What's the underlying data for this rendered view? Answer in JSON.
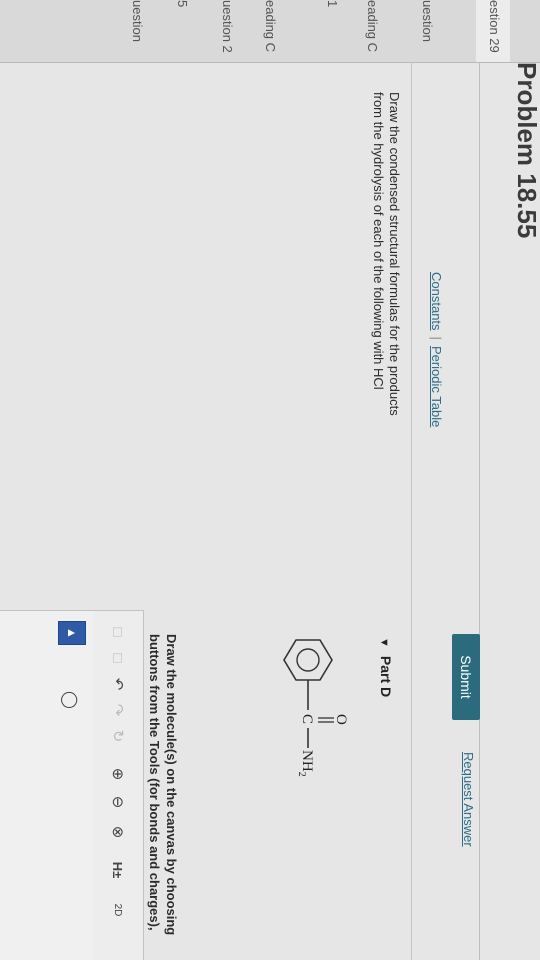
{
  "sidebar": {
    "items": [
      {
        "label": "estion 29"
      },
      {
        "label": "uestion"
      },
      {
        "label": "eading C"
      },
      {
        "label": "1"
      },
      {
        "label": "eading C"
      },
      {
        "label": "uestion 2"
      },
      {
        "label": "5"
      },
      {
        "label": "uestion"
      }
    ]
  },
  "header": {
    "title": "Problem 18.55"
  },
  "links": {
    "constants": "Constants",
    "separator": "|",
    "periodic_table": "Periodic Table"
  },
  "instructions": "Draw the condensed structural formulas for the products from the hydrolysis of each of the following with HCl",
  "actions": {
    "submit": "Submit",
    "request_answer": "Request Answer"
  },
  "part": {
    "label": "Part D"
  },
  "molecule": {
    "oxygen": "O",
    "carbon": "C",
    "amine": "NH",
    "amine_sub": "2"
  },
  "task": {
    "text": "Draw the molecule(s) on the canvas by choosing buttons from the Tools (for bonds and charges), Atoms, and Templates toolbars."
  },
  "toolbar": {
    "h_label": "H±",
    "d_label": "2D",
    "accent": "#2c6b7d"
  }
}
